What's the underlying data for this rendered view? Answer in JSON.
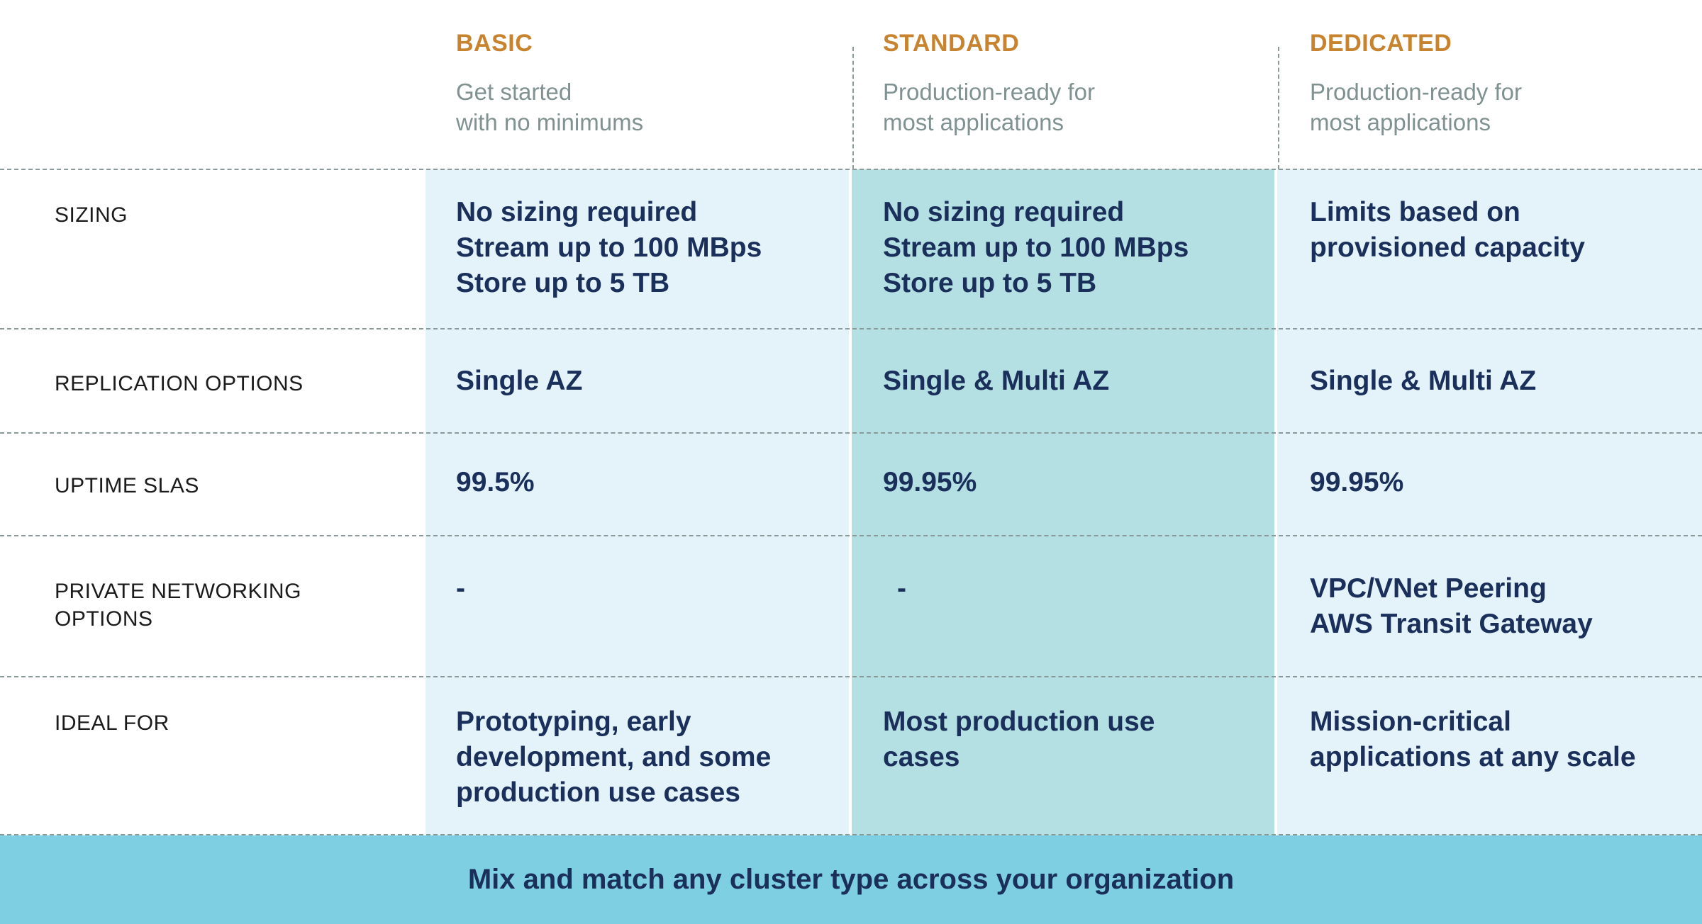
{
  "tiers": [
    {
      "name": "BASIC",
      "description_lines": [
        "Get started",
        "with no minimums"
      ]
    },
    {
      "name": "STANDARD",
      "description_lines": [
        "Production-ready for",
        "most applications"
      ]
    },
    {
      "name": "DEDICATED",
      "description_lines": [
        "Production-ready for",
        "most applications"
      ]
    }
  ],
  "rows": [
    {
      "label_lines": [
        "SIZING"
      ],
      "basic": [
        "No sizing required",
        "Stream up to 100 MBps",
        "Store up to 5 TB"
      ],
      "standard": [
        "No sizing required",
        "Stream up to 100 MBps",
        "Store up to 5 TB"
      ],
      "dedicated": [
        "Limits based on",
        "provisioned capacity"
      ]
    },
    {
      "label_lines": [
        "REPLICATION OPTIONS"
      ],
      "basic": [
        "Single AZ"
      ],
      "standard": [
        "Single & Multi AZ"
      ],
      "dedicated": [
        "Single & Multi AZ"
      ]
    },
    {
      "label_lines": [
        "UPTIME SLAS"
      ],
      "basic": [
        "99.5%"
      ],
      "standard": [
        "99.95%"
      ],
      "dedicated": [
        "99.95%"
      ]
    },
    {
      "label_lines": [
        "PRIVATE NETWORKING",
        "OPTIONS"
      ],
      "basic": [
        "-"
      ],
      "standard": [
        "-"
      ],
      "dedicated": [
        "VPC/VNet Peering",
        "AWS Transit Gateway"
      ]
    },
    {
      "label_lines": [
        "IDEAL FOR"
      ],
      "basic": [
        "Prototyping, early",
        "development, and some",
        "production use cases"
      ],
      "standard": [
        "Most production use",
        "cases"
      ],
      "dedicated": [
        "Mission-critical",
        "applications at any scale"
      ]
    }
  ],
  "footer": {
    "text": "Mix and match any cluster type across your organization"
  },
  "colors": {
    "tier_accent": "#c8832f",
    "cell_text": "#1a2f5a",
    "basic_bg": "#e4f3fa",
    "standard_bg": "#b4e0e3",
    "dedicated_bg": "#e4f3fa",
    "footer_bg": "#7fcfe2"
  }
}
